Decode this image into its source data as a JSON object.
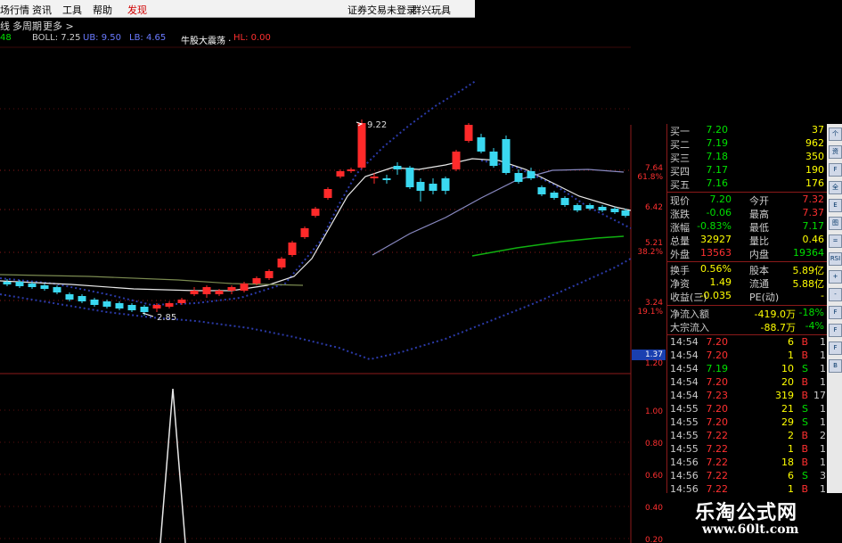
{
  "menubar": {
    "items": [
      "场行情",
      "资讯",
      "工具",
      "帮助",
      "发现"
    ],
    "right": [
      "证券交易未登录",
      "群兴玩具"
    ]
  },
  "toolbar2": {
    "items": [
      "线",
      "多周期",
      "更多 >"
    ]
  },
  "indicators": {
    "left_value": "48",
    "boll": "BOLL: 7.25",
    "up": "UB: 9.50",
    "lb": "LB: 4.65",
    "title": "牛股大震荡 ·",
    "hl": "HL: 0.00"
  },
  "price_axis": {
    "labels": [
      "7.64",
      "61.8%",
      "6.42",
      "5.21",
      "38.2%",
      "3.24",
      "19.1%",
      "1.37",
      "1.20"
    ],
    "current_box": "1.37"
  },
  "sub_axis": {
    "labels": [
      "1.00",
      "0.80",
      "0.60",
      "0.40",
      "0.20"
    ]
  },
  "annotations": {
    "high": "9.22",
    "low": "2.85"
  },
  "quote": {
    "bids": [
      {
        "label": "买一",
        "price": "7.20",
        "vol": "37"
      },
      {
        "label": "买二",
        "price": "7.19",
        "vol": "962"
      },
      {
        "label": "买三",
        "price": "7.18",
        "vol": "350"
      },
      {
        "label": "买四",
        "price": "7.17",
        "vol": "190"
      },
      {
        "label": "买五",
        "price": "7.16",
        "vol": "176"
      }
    ],
    "stats": [
      {
        "l1": "现价",
        "v1": "7.20",
        "l2": "今开",
        "v2": "7.32"
      },
      {
        "l1": "涨跌",
        "v1": "-0.06",
        "l2": "最高",
        "v2": "7.37"
      },
      {
        "l1": "涨幅",
        "v1": "-0.83%",
        "l2": "最低",
        "v2": "7.17"
      },
      {
        "l1": "总量",
        "v1": "32927",
        "l2": "量比",
        "v2": "0.46"
      },
      {
        "l1": "外盘",
        "v1": "13563",
        "l2": "内盘",
        "v2": "19364"
      }
    ],
    "stats2": [
      {
        "l1": "换手",
        "v1": "0.56%",
        "l2": "股本",
        "v2": "5.89亿"
      },
      {
        "l1": "净资",
        "v1": "1.49",
        "l2": "流通",
        "v2": "5.88亿"
      },
      {
        "l1": "收益(三)",
        "v1": "-0.035",
        "l2": "PE(动)",
        "v2": "-"
      }
    ],
    "flows": [
      {
        "label": "净流入额",
        "value": "-419.0万",
        "pct": "-18%"
      },
      {
        "label": "大宗流入",
        "value": "-88.7万",
        "pct": "-4%"
      }
    ],
    "ticks": [
      {
        "time": "14:54",
        "price": "7.20",
        "vol": "6",
        "side": "B",
        "n": "1"
      },
      {
        "time": "14:54",
        "price": "7.20",
        "vol": "1",
        "side": "B",
        "n": "1"
      },
      {
        "time": "14:54",
        "price": "7.19",
        "vol": "10",
        "side": "S",
        "n": "1"
      },
      {
        "time": "14:54",
        "price": "7.20",
        "vol": "20",
        "side": "B",
        "n": "1"
      },
      {
        "time": "14:54",
        "price": "7.23",
        "vol": "319",
        "side": "B",
        "n": "17"
      },
      {
        "time": "14:55",
        "price": "7.20",
        "vol": "21",
        "side": "S",
        "n": "1"
      },
      {
        "time": "14:55",
        "price": "7.20",
        "vol": "29",
        "side": "S",
        "n": "1"
      },
      {
        "time": "14:55",
        "price": "7.22",
        "vol": "2",
        "side": "B",
        "n": "2"
      },
      {
        "time": "14:55",
        "price": "7.22",
        "vol": "1",
        "side": "B",
        "n": "1"
      },
      {
        "time": "14:56",
        "price": "7.22",
        "vol": "18",
        "side": "B",
        "n": "1"
      },
      {
        "time": "14:56",
        "price": "7.22",
        "vol": "6",
        "side": "S",
        "n": "3"
      },
      {
        "time": "14:56",
        "price": "7.22",
        "vol": "1",
        "side": "B",
        "n": "1"
      }
    ]
  },
  "sidebar": {
    "icons": [
      "个",
      "资",
      "F",
      "全",
      "E",
      "图",
      "=",
      "RSI",
      "+",
      "-",
      "F",
      "F",
      "F",
      "B"
    ]
  },
  "watermark": {
    "name": "乐淘公式网",
    "url": "www.60lt.com"
  },
  "colors": {
    "up": "#ff2a2a",
    "down": "#3ad8f0",
    "frame": "#8b1a1a",
    "yellow": "#ffff00",
    "green": "#00e000"
  }
}
